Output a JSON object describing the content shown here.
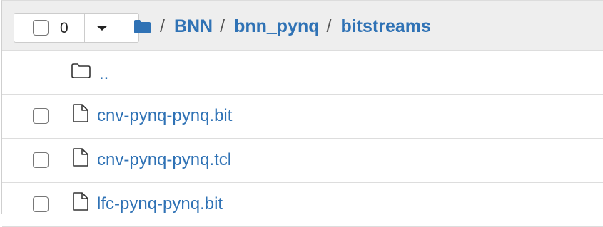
{
  "toolbar": {
    "selected_count": "0"
  },
  "breadcrumb": {
    "items": [
      "BNN",
      "bnn_pynq",
      "bitstreams"
    ],
    "separator": "/"
  },
  "rows": [
    {
      "name": "..",
      "type": "folder"
    },
    {
      "name": "cnv-pynq-pynq.bit",
      "type": "file"
    },
    {
      "name": "cnv-pynq-pynq.tcl",
      "type": "file"
    },
    {
      "name": "lfc-pynq-pynq.bit",
      "type": "file"
    }
  ],
  "colors": {
    "link": "#2f72b5",
    "header_bg": "#eeeeee",
    "border": "#dddddd"
  },
  "icons": [
    "folder-icon",
    "file-icon",
    "chevron-down-icon"
  ]
}
